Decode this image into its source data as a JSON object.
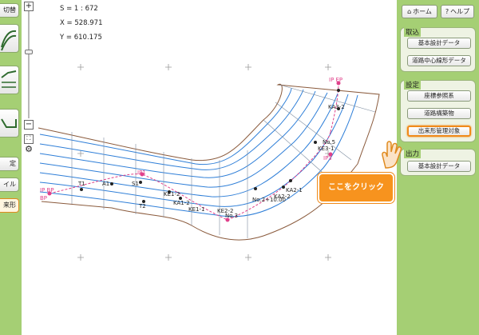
{
  "status": {
    "scale": "S = 1 : 672",
    "x": "X = 528.971",
    "y": "Y = 610.175"
  },
  "zoom": {
    "plus": "+",
    "minus": "−",
    "level": 0.62
  },
  "left_toolbar": {
    "switch_label": "切替",
    "settings_label": "定",
    "file_label": "イル",
    "result_label": "来形"
  },
  "right_panel": {
    "home_label": "ホーム",
    "help_label": "ヘルプ",
    "import_group": {
      "title": "取込",
      "buttons": [
        "基本設計データ",
        "道路中心線形データ"
      ]
    },
    "settings_group": {
      "title": "設定",
      "buttons": [
        "座標参照系",
        "道路構築物",
        "出来形管理対象"
      ]
    },
    "output_group": {
      "title": "出力",
      "buttons": [
        "基本設計データ"
      ]
    }
  },
  "callout": {
    "text": "ここをクリック"
  },
  "map_labels": {
    "ip_bp": "IP BP",
    "bp": "BP",
    "t1": "T1",
    "a1": "A1",
    "s1": "S1",
    "ip1": "IP1",
    "ke12": "KE1-2",
    "ka12": "KA1-2",
    "ke11": "KE1-1",
    "t2": "T2",
    "ke22": "KE2-2",
    "no3": "No.3",
    "no2": "No.2+10.00",
    "ka22": "KA2-2",
    "ka21": "KA2-1",
    "no5": "No.5",
    "ke31": "KE3-1",
    "ip3": "IP3",
    "ka32": "KA3-2",
    "ip_ep": "IP EP"
  },
  "colors": {
    "panel_green": "#a5cf74",
    "callout_orange": "#f7931e",
    "road_blue": "#2f7fd8",
    "edge_brown": "#8a5a3c",
    "alignment_magenta": "#e0408a"
  }
}
